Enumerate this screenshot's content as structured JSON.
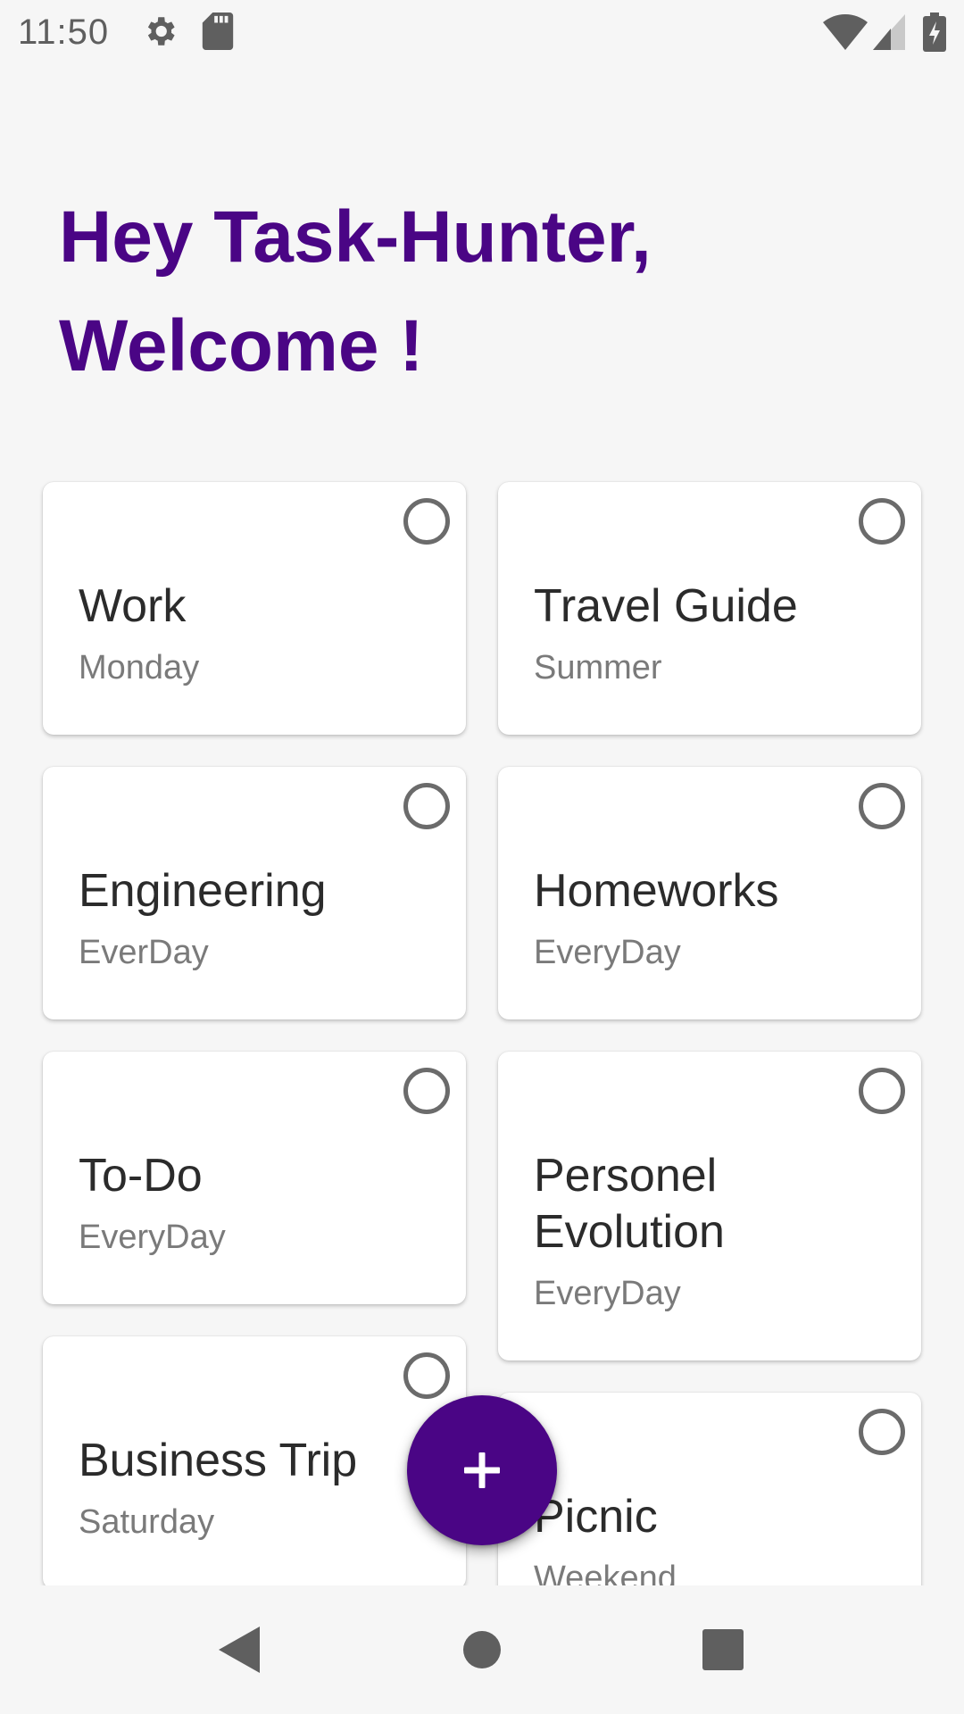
{
  "status_bar": {
    "time": "11:50",
    "icons": [
      "settings-icon",
      "sd-card-icon",
      "wifi-icon",
      "signal-icon",
      "battery-charging-icon"
    ]
  },
  "header": {
    "line1": "Hey Task-Hunter,",
    "line2": "Welcome !"
  },
  "colors": {
    "accent": "#4a0585",
    "background": "#f6f6f6",
    "card": "#ffffff",
    "title_text": "#2b2b2b",
    "subtitle_text": "#7a7a7a"
  },
  "cards": {
    "left": [
      {
        "title": "Work",
        "subtitle": "Monday"
      },
      {
        "title": "Engineering",
        "subtitle": "EverDay"
      },
      {
        "title": "To-Do",
        "subtitle": "EveryDay"
      },
      {
        "title": "Business Trip",
        "subtitle": "Saturday"
      }
    ],
    "right": [
      {
        "title": "Travel Guide",
        "subtitle": "Summer"
      },
      {
        "title": "Homeworks",
        "subtitle": "EveryDay"
      },
      {
        "title": "Personel Evolution",
        "subtitle": "EveryDay"
      },
      {
        "title": "Picnic",
        "subtitle": "Weekend"
      }
    ]
  },
  "fab": {
    "icon": "plus-icon"
  },
  "nav_bar": {
    "icons": [
      "back-icon",
      "home-icon",
      "recents-icon"
    ]
  }
}
